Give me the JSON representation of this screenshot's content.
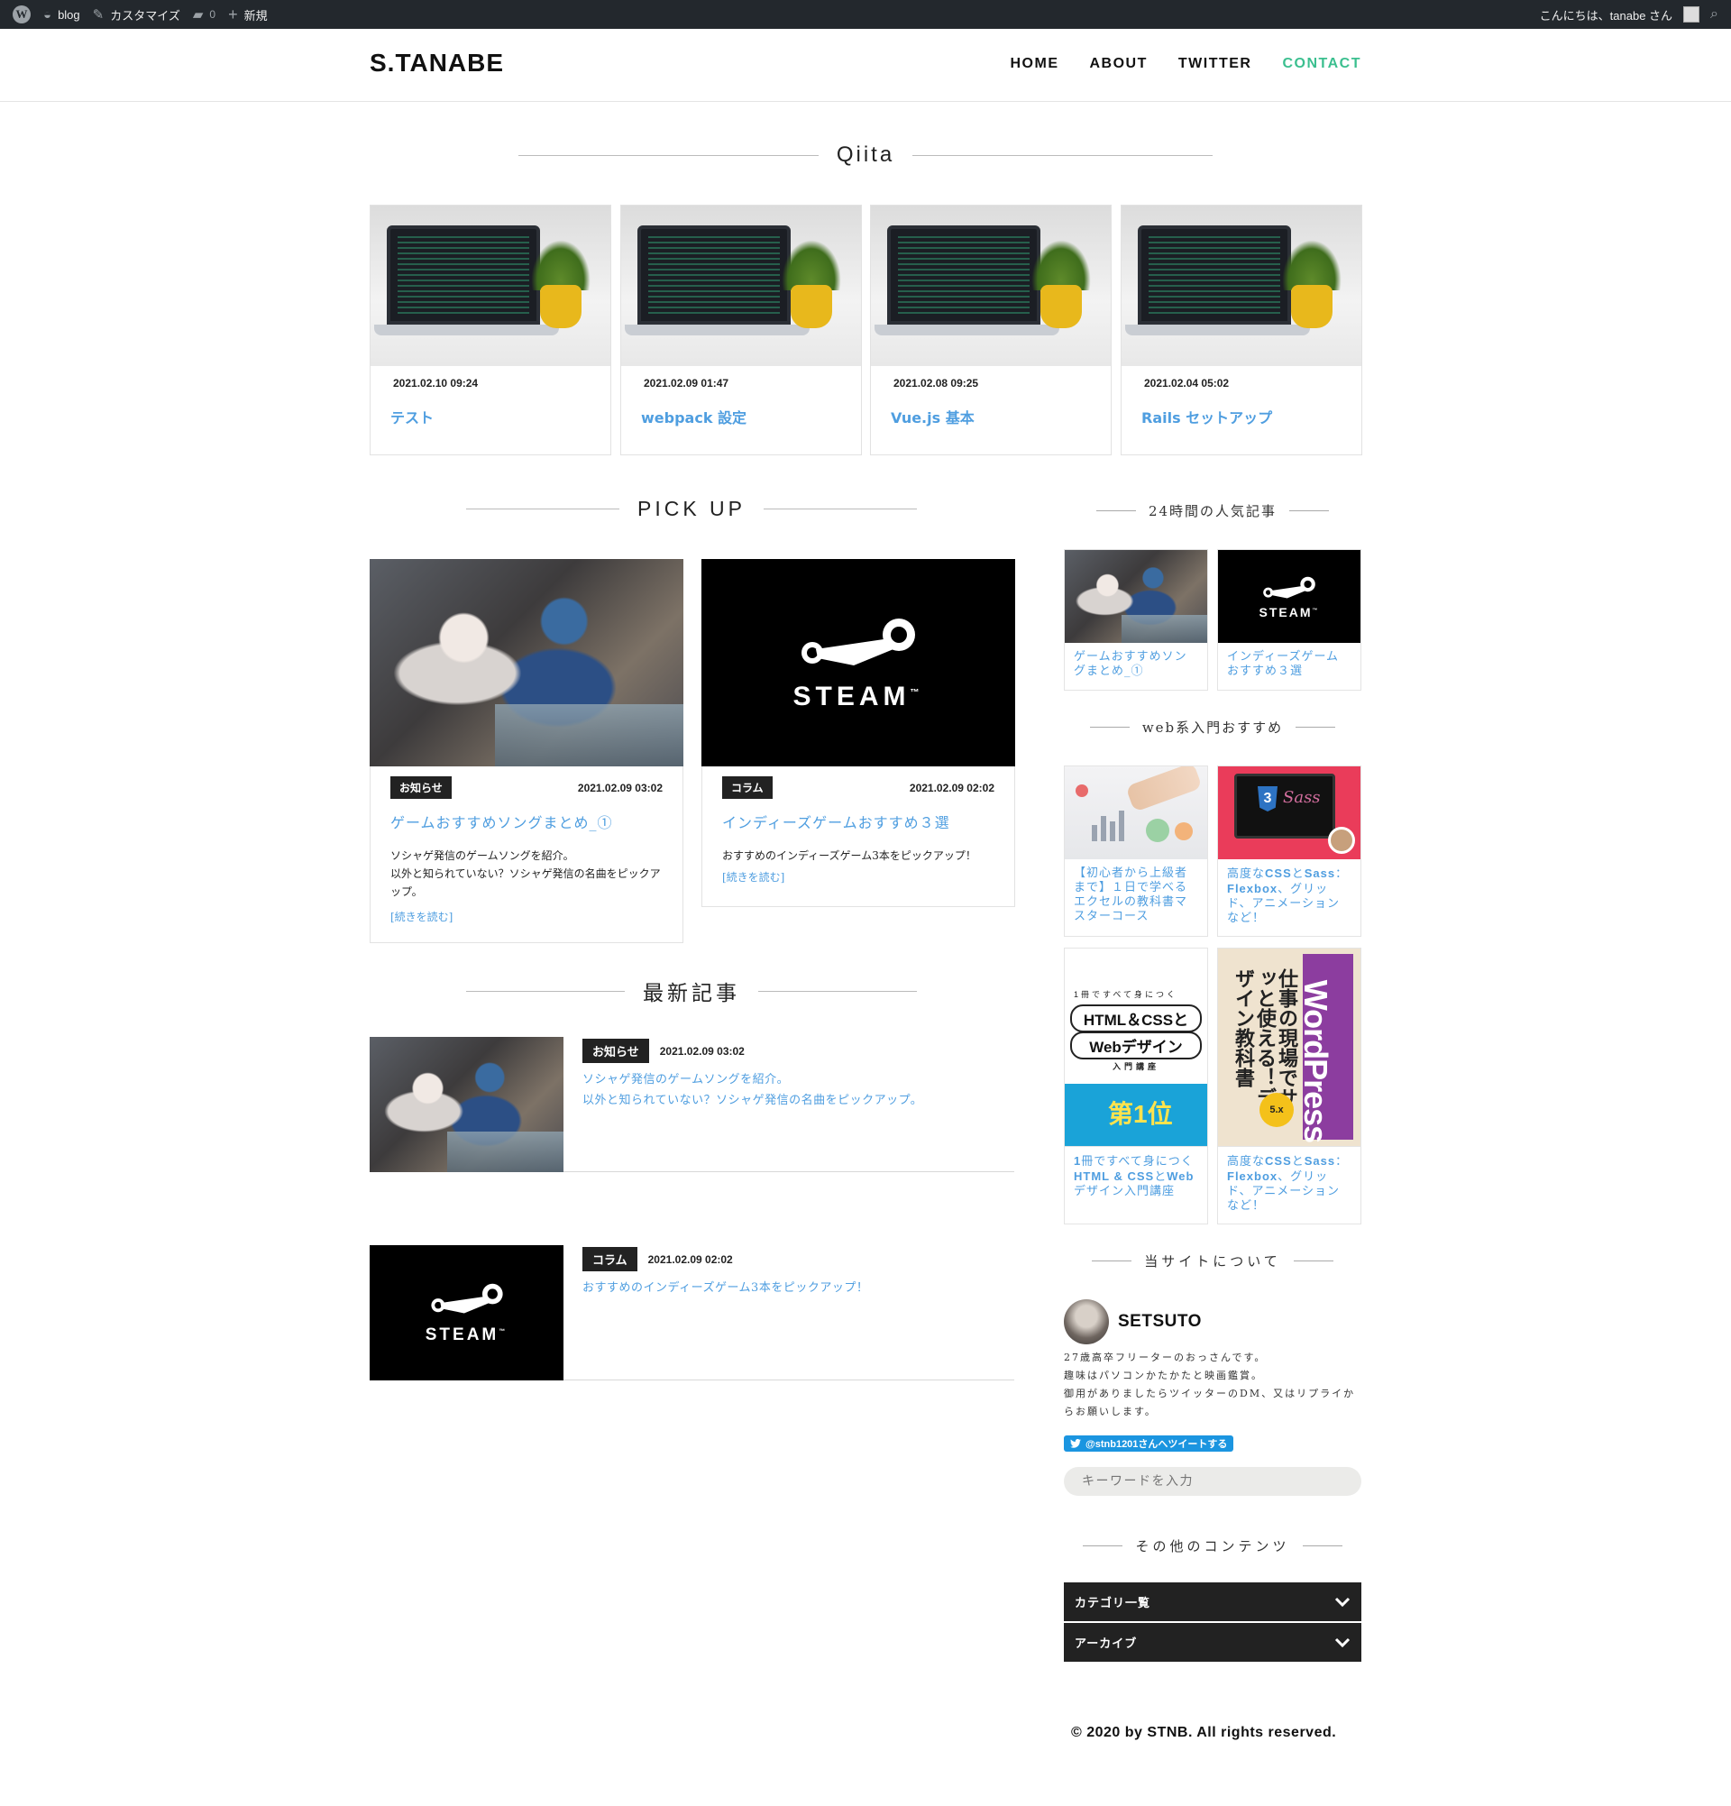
{
  "admin_bar": {
    "site": "blog",
    "customize": "カスタマイズ",
    "comments": "0",
    "new": "新規",
    "greeting": "こんにちは、tanabe さん"
  },
  "header": {
    "logo": "S.TANABE",
    "nav": [
      "HOME",
      "ABOUT",
      "TWITTER",
      "CONTACT"
    ],
    "active_nav": "CONTACT"
  },
  "qiita": {
    "heading": "Qiita",
    "cards": [
      {
        "date": "2021.02.10 09:24",
        "title": "テスト"
      },
      {
        "date": "2021.02.09 01:47",
        "title": "webpack 設定"
      },
      {
        "date": "2021.02.08 09:25",
        "title": "Vue.js 基本"
      },
      {
        "date": "2021.02.04 05:02",
        "title": "Rails セットアップ"
      }
    ]
  },
  "pickup": {
    "heading": "PICK UP",
    "cards": [
      {
        "tag": "お知らせ",
        "date": "2021.02.09 03:02",
        "title": "ゲームおすすめソングまとめ_①",
        "excerpt_1": "ソシャゲ発信のゲームソングを紹介。",
        "excerpt_2": "以外と知られていない？ソシャゲ発信の名曲をピックアップ。",
        "more": "[続きを読む]"
      },
      {
        "tag": "コラム",
        "date": "2021.02.09 02:02",
        "title": "インディーズゲームおすすめ３選",
        "excerpt_1": "おすすめのインディーズゲーム3本をピックアップ！",
        "more": "[続きを読む]"
      }
    ]
  },
  "latest": {
    "heading": "最新記事",
    "items": [
      {
        "tag": "お知らせ",
        "date": "2021.02.09 03:02",
        "excerpt_1": "ソシャゲ発信のゲームソングを紹介。",
        "excerpt_2": "以外と知られていない？ソシャゲ発信の名曲をピックアップ。"
      },
      {
        "tag": "コラム",
        "date": "2021.02.09 02:02",
        "excerpt_1": "おすすめのインディーズゲーム3本をピックアップ！"
      }
    ]
  },
  "thumb_text": {
    "steam": "STEAM",
    "tm": "™"
  },
  "sidebar": {
    "popular_heading": "24時間の人気記事",
    "popular": [
      {
        "title": "ゲームおすすめソングまとめ_①"
      },
      {
        "title": "インディーズゲームおすすめ３選"
      }
    ],
    "web_heading": "web系入門おすすめ",
    "web": [
      {
        "title": "【初心者から上級者まで】１日で学べるエクセルの教科書マスターコース"
      },
      {
        "title_b1": "高度な",
        "title_b2": "CSS",
        "title_c1": "と",
        "title_b3": "Sass",
        "title_c2": "：",
        "title_b4": "Flexbox",
        "title_c3": "、グリッド、アニメーションなど！"
      },
      {
        "title_b1": "1",
        "title_c1": "冊ですべて身につく",
        "title_b2": "HTML & CSS",
        "title_c2": "と",
        "title_b3": "Web",
        "title_c3": "デザイン入門講座"
      },
      {
        "title_b1": "高度な",
        "title_b2": "CSS",
        "title_c1": "と",
        "title_b3": "Sass",
        "title_c2": "：",
        "title_b4": "Flexbox",
        "title_c3": "、グリッド、アニメーションなど！"
      }
    ],
    "book1": {
      "sub": "1冊ですべて身につく",
      "line1": "HTML＆CSSと",
      "line2": "Webデザイン",
      "line3": "入門講座",
      "rank": "第1位"
    },
    "book2": {
      "title": "仕事の現場でサッと使える！デザイン教科書",
      "brand": "WordPress",
      "badge": "5.x"
    },
    "about_heading": "当サイトについて",
    "about_name": "SETSUTO",
    "about_text_1": "27歳高卒フリーターのおっさんです。",
    "about_text_2": "趣味はパソコンかたかたと映画鑑賞。",
    "about_text_3": "御用がありましたらツイッターのDM、又はリプライからお願いします。",
    "tweet_button": "@stnb1201さんへツイートする",
    "search_placeholder": "キーワードを入力",
    "other_heading": "その他のコンテンツ",
    "accordions": [
      "カテゴリ一覧",
      "アーカイブ"
    ]
  },
  "footer": {
    "copyright": "© 2020 by STNB. All rights reserved."
  },
  "colors": {
    "link": "#4f9ee0",
    "accent": "#3bbf8f",
    "dark": "#222222"
  }
}
